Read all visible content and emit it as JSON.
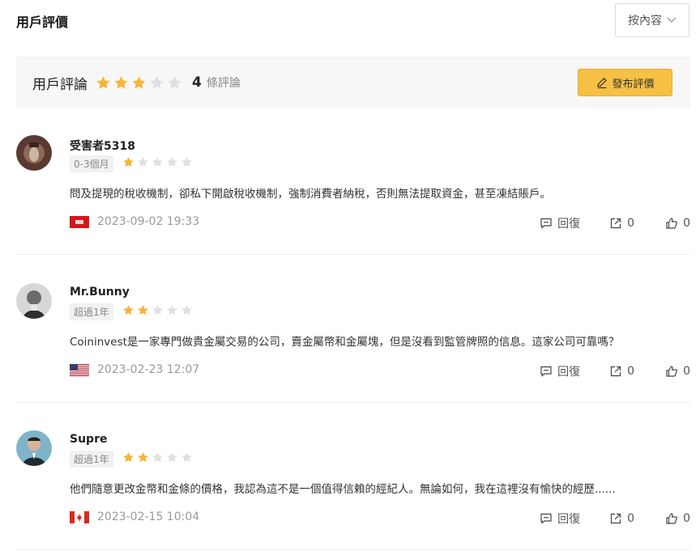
{
  "page": {
    "title": "用戶評價"
  },
  "sort": {
    "label": "按內容"
  },
  "summary": {
    "title": "用戶評論",
    "rating": 3,
    "max_rating": 5,
    "count": "4",
    "count_label": "條評論",
    "write_button": "發布評價"
  },
  "colors": {
    "accent": "#f5c044",
    "star_on": "#f5b53a",
    "star_off": "#e0e0e0"
  },
  "reviews": [
    {
      "name": "受害者5318",
      "tenure": "0-3個月",
      "rating": 1,
      "text": "問及提現的稅收機制，卻私下開啟稅收機制，強制消費者納稅，否則無法提取資金，甚至凍結賬戶。",
      "flag": "hk-red-flag-icon",
      "date": "2023-09-02 19:33",
      "reply_label": "回復",
      "share_count": "0",
      "like_count": "0"
    },
    {
      "name": "Mr.Bunny",
      "tenure": "超過1年",
      "rating": 2,
      "text": "Coininvest是一家專門做貴金屬交易的公司，賣金屬幣和金屬塊，但是沒看到監管牌照的信息。這家公司可靠嗎？",
      "flag": "us-flag-icon",
      "date": "2023-02-23 12:07",
      "reply_label": "回復",
      "share_count": "0",
      "like_count": "0"
    },
    {
      "name": "Supre",
      "tenure": "超過1年",
      "rating": 2,
      "text": "他們隨意更改金幣和金條的價格，我認為這不是一個值得信賴的經紀人。無論如何，我在這裡沒有愉快的經歷......",
      "flag": "canada-flag-icon",
      "date": "2023-02-15 10:04",
      "reply_label": "回復",
      "share_count": "0",
      "like_count": "0"
    }
  ]
}
